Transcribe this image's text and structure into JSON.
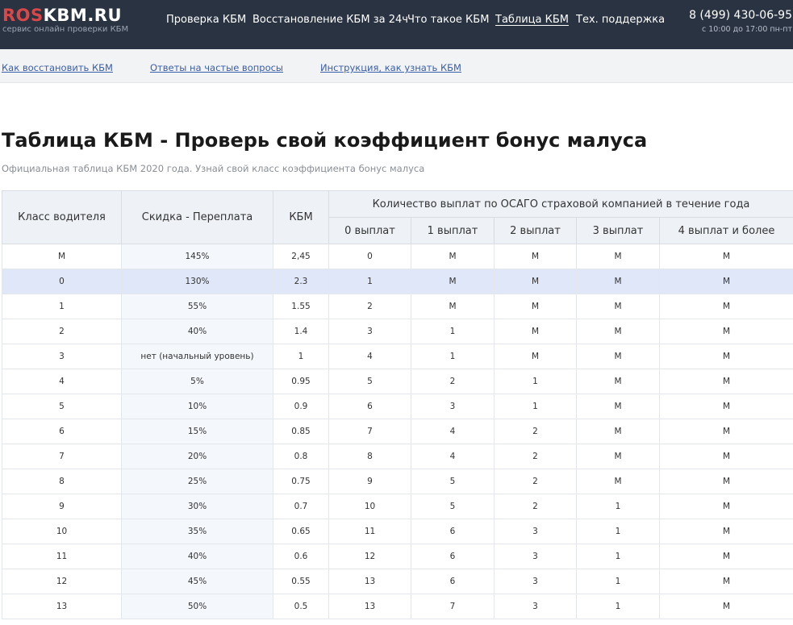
{
  "header": {
    "logo_red": "ROS",
    "logo_white": "KBM.RU",
    "logo_sub": "сервис онлайн проверки КБМ",
    "nav": [
      {
        "label": "Проверка КБМ",
        "active": false
      },
      {
        "label": "Восстановление КБМ за 24ч",
        "active": false
      },
      {
        "label": "Что такое КБМ",
        "active": false
      },
      {
        "label": "Таблица КБМ",
        "active": true
      },
      {
        "label": "Тех. поддержка",
        "active": false
      }
    ],
    "phone": "8 (499) 430-06-95",
    "hours": "с 10:00 до 17:00 пн-пт"
  },
  "sublinks": [
    "Как восстановить КБМ",
    "Ответы на частые вопросы",
    "Инструкция, как узнать КБМ"
  ],
  "title_bold": "Таблица КБМ -",
  "title_rest": "Проверь свой коэффициент бонус малуса",
  "subtitle": "Официальная таблица КБМ 2020 года. Узнай свой класс коэффициента бонус малуса",
  "table": {
    "headers": {
      "class": "Класс водителя",
      "discount": "Скидка - Переплата",
      "kbm": "КБМ",
      "group": "Количество выплат по ОСАГО страховой компанией в течение года",
      "p0": "0 выплат",
      "p1": "1 выплат",
      "p2": "2 выплат",
      "p3": "3 выплат",
      "p4": "4 выплат и более"
    },
    "rows": [
      {
        "cls": "М",
        "disc": "145%",
        "kbm": "2,45",
        "p0": "0",
        "p1": "М",
        "p2": "М",
        "p3": "М",
        "p4": "М",
        "tone": "red"
      },
      {
        "cls": "0",
        "disc": "130%",
        "kbm": "2.3",
        "p0": "1",
        "p1": "М",
        "p2": "М",
        "p3": "М",
        "p4": "М",
        "tone": "red",
        "highlight": true
      },
      {
        "cls": "1",
        "disc": "55%",
        "kbm": "1.55",
        "p0": "2",
        "p1": "М",
        "p2": "М",
        "p3": "М",
        "p4": "М",
        "tone": "red"
      },
      {
        "cls": "2",
        "disc": "40%",
        "kbm": "1.4",
        "p0": "3",
        "p1": "1",
        "p2": "М",
        "p3": "М",
        "p4": "М",
        "tone": "red"
      },
      {
        "cls": "3",
        "disc": "нет (начальный уровень)",
        "kbm": "1",
        "p0": "4",
        "p1": "1",
        "p2": "М",
        "p3": "М",
        "p4": "М",
        "tone": "neutral"
      },
      {
        "cls": "4",
        "disc": "5%",
        "kbm": "0.95",
        "p0": "5",
        "p1": "2",
        "p2": "1",
        "p3": "М",
        "p4": "М",
        "tone": "green"
      },
      {
        "cls": "5",
        "disc": "10%",
        "kbm": "0.9",
        "p0": "6",
        "p1": "3",
        "p2": "1",
        "p3": "М",
        "p4": "М",
        "tone": "green"
      },
      {
        "cls": "6",
        "disc": "15%",
        "kbm": "0.85",
        "p0": "7",
        "p1": "4",
        "p2": "2",
        "p3": "М",
        "p4": "М",
        "tone": "green"
      },
      {
        "cls": "7",
        "disc": "20%",
        "kbm": "0.8",
        "p0": "8",
        "p1": "4",
        "p2": "2",
        "p3": "М",
        "p4": "М",
        "tone": "teal"
      },
      {
        "cls": "8",
        "disc": "25%",
        "kbm": "0.75",
        "p0": "9",
        "p1": "5",
        "p2": "2",
        "p3": "М",
        "p4": "М",
        "tone": "teal"
      },
      {
        "cls": "9",
        "disc": "30%",
        "kbm": "0.7",
        "p0": "10",
        "p1": "5",
        "p2": "2",
        "p3": "1",
        "p4": "М",
        "tone": "teal"
      },
      {
        "cls": "10",
        "disc": "35%",
        "kbm": "0.65",
        "p0": "11",
        "p1": "6",
        "p2": "3",
        "p3": "1",
        "p4": "М",
        "tone": "teal"
      },
      {
        "cls": "11",
        "disc": "40%",
        "kbm": "0.6",
        "p0": "12",
        "p1": "6",
        "p2": "3",
        "p3": "1",
        "p4": "М",
        "tone": "teal"
      },
      {
        "cls": "12",
        "disc": "45%",
        "kbm": "0.55",
        "p0": "13",
        "p1": "6",
        "p2": "3",
        "p3": "1",
        "p4": "М",
        "tone": "teal"
      },
      {
        "cls": "13",
        "disc": "50%",
        "kbm": "0.5",
        "p0": "13",
        "p1": "7",
        "p2": "3",
        "p3": "1",
        "p4": "М",
        "tone": "teal"
      }
    ]
  },
  "colors": {
    "header_bg": "#2a3342",
    "logo_red": "#d84848",
    "link": "#3a5ea8",
    "highlight_row": "#dfe7f8",
    "tone_red": "#c0392b",
    "tone_green": "#3aa14a",
    "tone_teal": "#1f8f9a"
  }
}
